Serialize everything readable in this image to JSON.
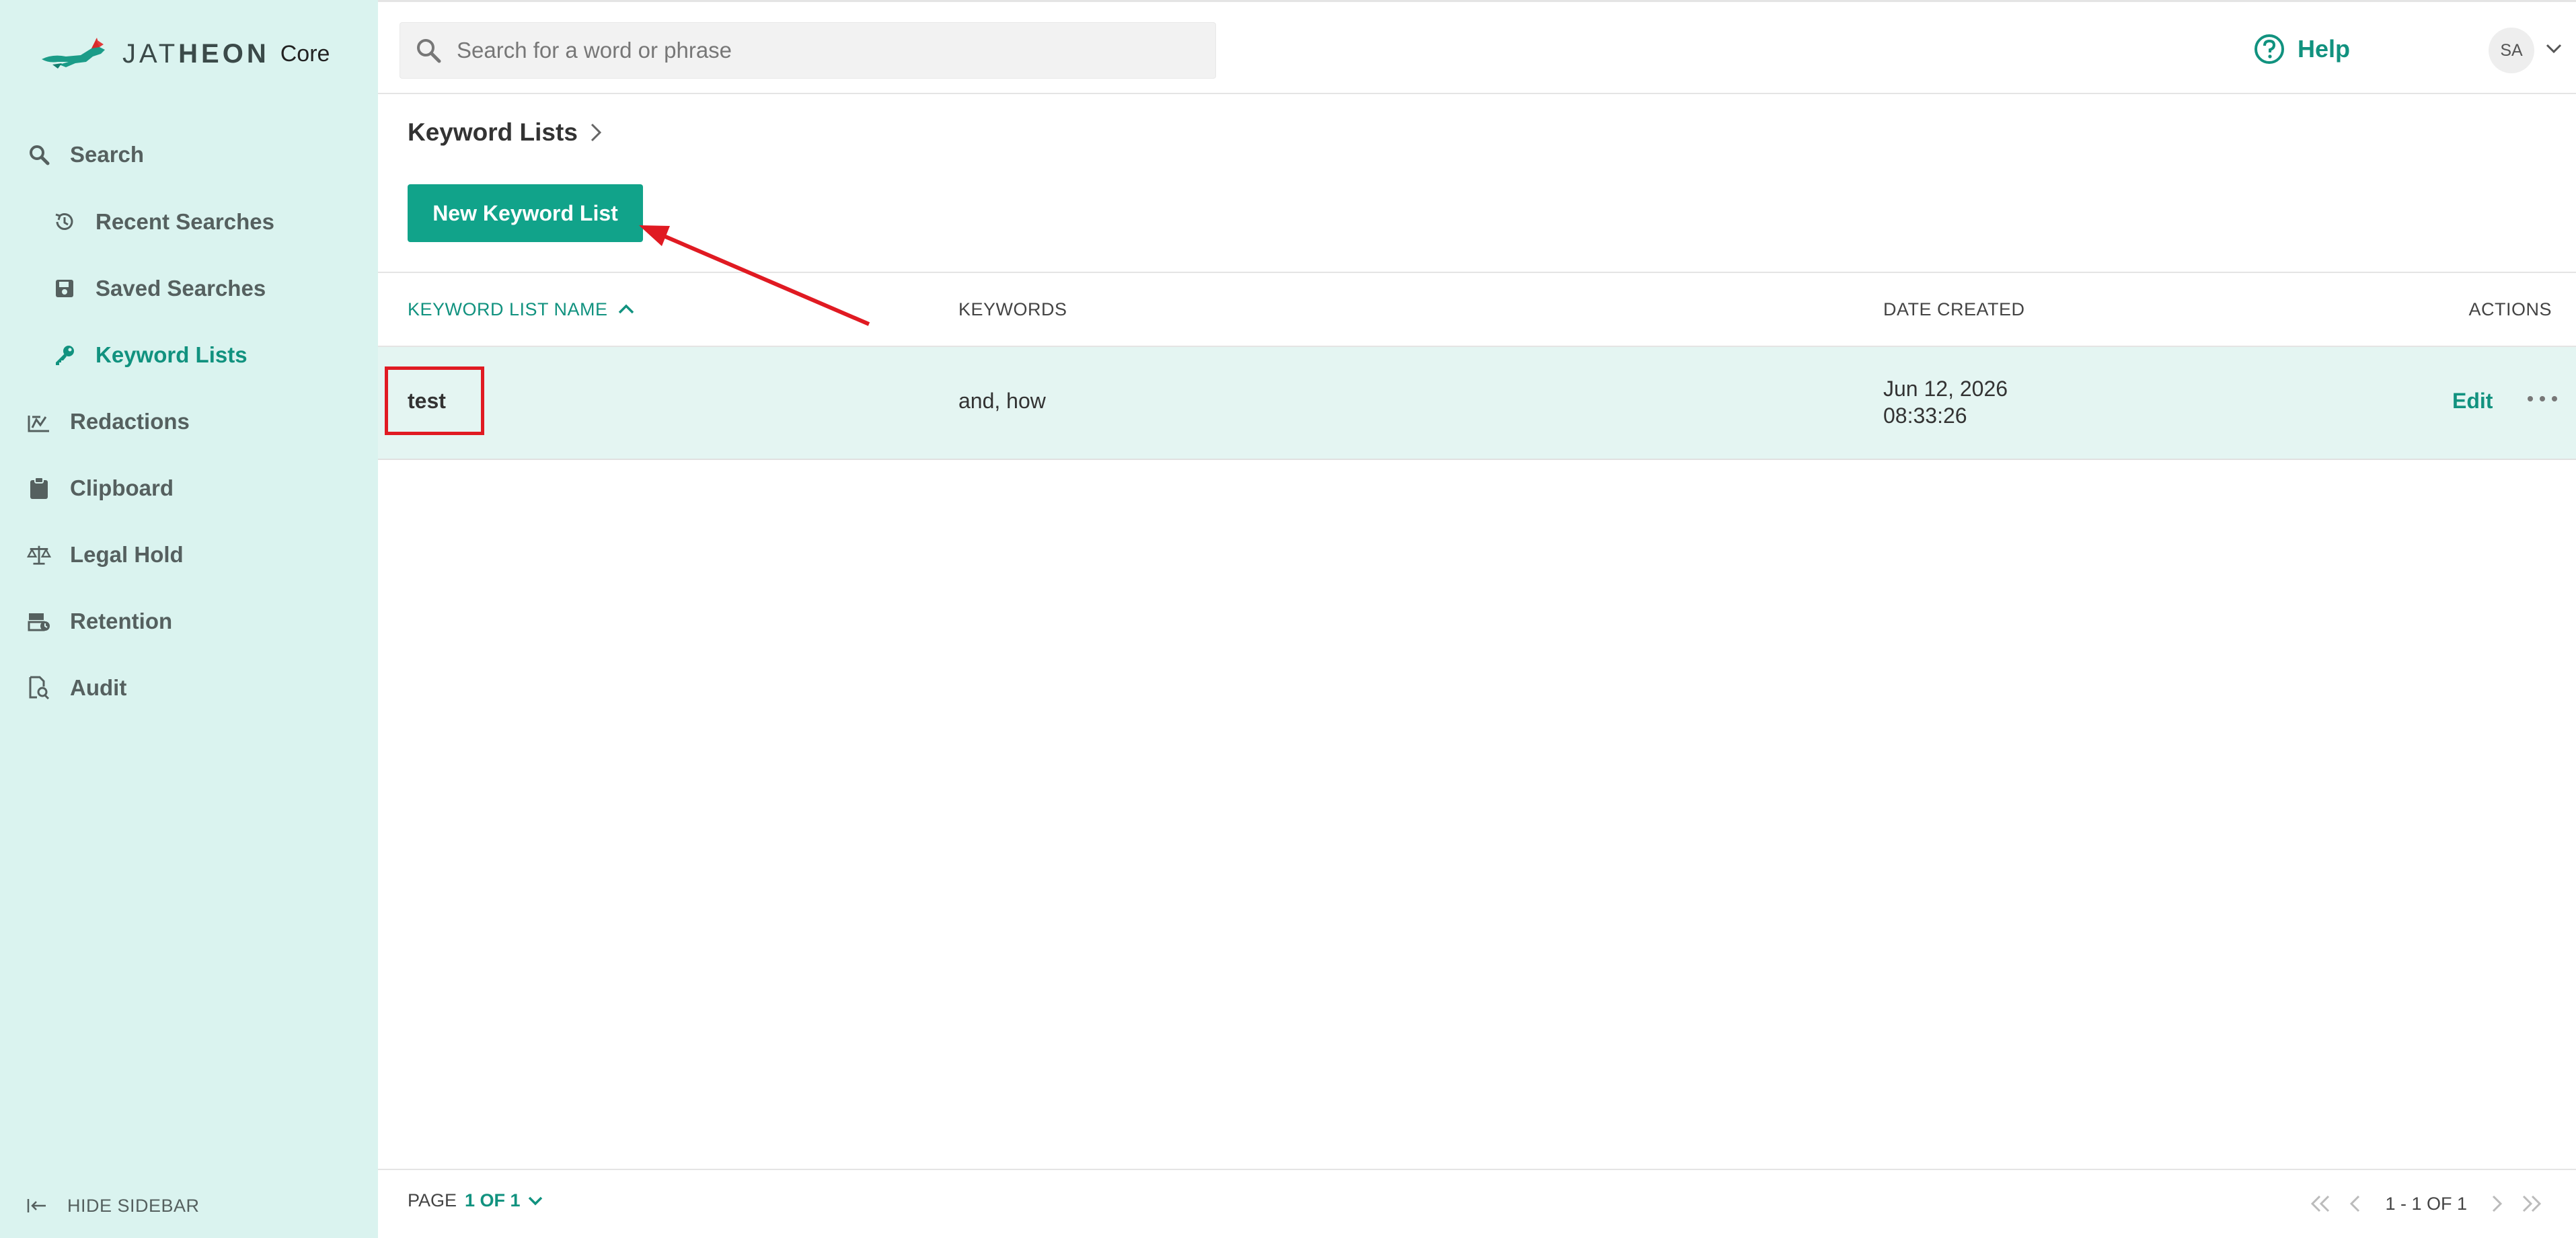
{
  "brand": {
    "wordmark_light": "JAT",
    "wordmark_bold": "HEON",
    "product": "Core",
    "accent_color": "#11a38a",
    "sidebar_bg": "#daf3ef"
  },
  "sidebar": {
    "items": [
      {
        "label": "Search",
        "icon": "search-icon"
      },
      {
        "label": "Recent Searches",
        "icon": "history-icon"
      },
      {
        "label": "Saved Searches",
        "icon": "save-icon"
      },
      {
        "label": "Keyword Lists",
        "icon": "key-icon",
        "active": true
      },
      {
        "label": "Redactions",
        "icon": "redaction-icon"
      },
      {
        "label": "Clipboard",
        "icon": "clipboard-icon"
      },
      {
        "label": "Legal Hold",
        "icon": "scale-icon"
      },
      {
        "label": "Retention",
        "icon": "retention-icon"
      },
      {
        "label": "Audit",
        "icon": "audit-icon"
      }
    ],
    "hide_label": "HIDE SIDEBAR"
  },
  "header": {
    "search_placeholder": "Search for a word or phrase",
    "help_label": "Help",
    "avatar_initials": "SA"
  },
  "main": {
    "breadcrumb": "Keyword Lists",
    "new_button_label": "New Keyword List",
    "table": {
      "columns": [
        "KEYWORD LIST NAME",
        "KEYWORDS",
        "DATE CREATED",
        "ACTIONS"
      ],
      "rows": [
        {
          "name": "test",
          "keywords": "and, how",
          "date_line1": "Jun 12, 2026",
          "date_line2": "08:33:26",
          "edit_label": "Edit"
        }
      ]
    }
  },
  "footer": {
    "page_label": "PAGE",
    "page_value": "1 OF 1",
    "range": "1 - 1 OF 1"
  },
  "annotations": {
    "highlight_color": "#e01a22"
  }
}
